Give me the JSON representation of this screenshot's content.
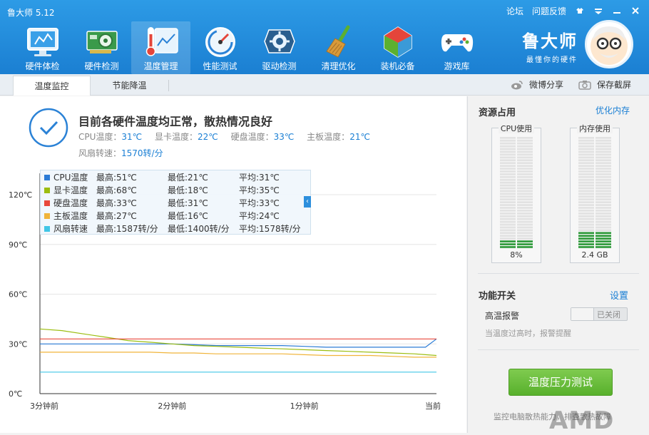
{
  "app": {
    "title": "鲁大师 5.12",
    "links": {
      "forum": "论坛",
      "feedback": "问题反馈"
    }
  },
  "brand": {
    "name": "鲁大师",
    "slogan": "最懂你的硬件"
  },
  "nav": {
    "items": [
      {
        "label": "硬件体检"
      },
      {
        "label": "硬件检测"
      },
      {
        "label": "温度管理"
      },
      {
        "label": "性能测试"
      },
      {
        "label": "驱动检测"
      },
      {
        "label": "清理优化"
      },
      {
        "label": "装机必备"
      },
      {
        "label": "游戏库"
      }
    ]
  },
  "tabs": [
    {
      "label": "温度监控"
    },
    {
      "label": "节能降温"
    }
  ],
  "toolbar": {
    "share": "微博分享",
    "screenshot": "保存截屏"
  },
  "status": {
    "title": "目前各硬件温度均正常，散热情况良好",
    "cpu_label": "CPU温度：",
    "cpu_value": "31℃",
    "gpu_label": "显卡温度：",
    "gpu_value": "22℃",
    "disk_label": "硬盘温度：",
    "disk_value": "33℃",
    "board_label": "主板温度：",
    "board_value": "21℃",
    "fan_label": "风扇转速：",
    "fan_value": "1570转/分"
  },
  "legend": [
    {
      "name": "CPU温度",
      "max": "最高:51℃",
      "min": "最低:21℃",
      "avg": "平均:31℃",
      "color": "#2b7bd6"
    },
    {
      "name": "显卡温度",
      "max": "最高:68℃",
      "min": "最低:18℃",
      "avg": "平均:35℃",
      "color": "#9cbd10"
    },
    {
      "name": "硬盘温度",
      "max": "最高:33℃",
      "min": "最低:31℃",
      "avg": "平均:33℃",
      "color": "#e8483b"
    },
    {
      "name": "主板温度",
      "max": "最高:27℃",
      "min": "最低:16℃",
      "avg": "平均:24℃",
      "color": "#f0b43a"
    },
    {
      "name": "风扇转速",
      "max": "最高:1587转/分",
      "min": "最低:1400转/分",
      "avg": "平均:1578转/分",
      "color": "#40c6e6"
    }
  ],
  "chart_data": {
    "type": "line",
    "y_ticks": [
      "0℃",
      "30℃",
      "60℃",
      "90℃",
      "120℃"
    ],
    "x_ticks": [
      "3分钟前",
      "2分钟前",
      "1分钟前",
      "当前"
    ],
    "ylim": [
      0,
      120
    ],
    "xlim": [
      0,
      180
    ],
    "x": [
      0,
      10,
      20,
      30,
      40,
      50,
      60,
      70,
      80,
      90,
      100,
      110,
      120,
      130,
      140,
      150,
      160,
      170,
      175,
      180
    ],
    "series": [
      {
        "name": "CPU温度",
        "values": [
          30,
          30,
          30,
          30,
          30,
          30,
          30,
          29.5,
          29,
          29,
          29,
          29,
          28.5,
          28,
          28,
          28,
          28,
          28,
          28,
          33
        ]
      },
      {
        "name": "显卡温度",
        "values": [
          39,
          38,
          36,
          34,
          32,
          31,
          30,
          29,
          28.5,
          28,
          27.5,
          27,
          26.5,
          26,
          25.5,
          25,
          24.5,
          24,
          23.5,
          23
        ]
      },
      {
        "name": "硬盘温度",
        "values": [
          33,
          33,
          33,
          33,
          33,
          33,
          33,
          33,
          33,
          33,
          33,
          33,
          33,
          33,
          33,
          33,
          33,
          33,
          33,
          33
        ]
      },
      {
        "name": "主板温度",
        "values": [
          25,
          25,
          25,
          25,
          25,
          25,
          24.5,
          24.5,
          24,
          24,
          24,
          24,
          23.5,
          23,
          23,
          23,
          22.5,
          22,
          22,
          22
        ]
      },
      {
        "name": "风扇转速",
        "values": [
          13,
          13,
          13,
          13,
          13,
          13,
          13,
          13,
          13,
          13,
          13,
          13,
          13,
          13,
          13,
          13,
          13,
          13,
          13,
          13
        ]
      }
    ],
    "colors": [
      "#2b7bd6",
      "#9cbd10",
      "#e8483b",
      "#f0b43a",
      "#40c6e6"
    ]
  },
  "side": {
    "resources_title": "资源占用",
    "optimize_link": "优化内存",
    "cpu_label": "CPU使用",
    "cpu_value": "8%",
    "cpu_fraction": 0.08,
    "mem_label": "内存使用",
    "mem_value": "2.4 GB",
    "mem_fraction": 0.15,
    "switch_title": "功能开关",
    "settings_link": "设置",
    "alarm_label": "高温报警",
    "alarm_state": "已关闭",
    "alarm_desc": "当温度过高时，报警提醒",
    "stress_button": "温度压力测试",
    "footer": "监控电脑散热能力，排查散热故障"
  },
  "watermark": "AMD"
}
